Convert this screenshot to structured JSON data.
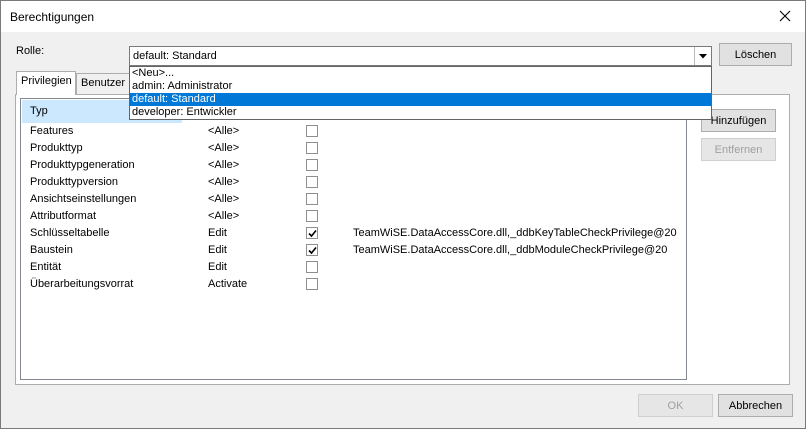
{
  "window": {
    "title": "Berechtigungen"
  },
  "rolle": {
    "label": "Rolle:",
    "selected": "default: Standard",
    "options": [
      "<Neu>...",
      "admin: Administrator",
      "default: Standard",
      "developer: Entwickler"
    ],
    "highlighted_index": 2
  },
  "buttons": {
    "loeschen": "Löschen",
    "hinzufuegen": "Hinzufügen",
    "entfernen": "Entfernen",
    "ok": "OK",
    "abbrechen": "Abbrechen"
  },
  "tabs": [
    {
      "label": "Privilegien",
      "active": true
    },
    {
      "label": "Benutzer",
      "active": false
    }
  ],
  "list": {
    "header": "Typ",
    "rows": [
      {
        "name": "Features",
        "level": "<Alle>",
        "checked": false,
        "info": ""
      },
      {
        "name": "Produkttyp",
        "level": "<Alle>",
        "checked": false,
        "info": ""
      },
      {
        "name": "Produkttypgeneration",
        "level": "<Alle>",
        "checked": false,
        "info": ""
      },
      {
        "name": "Produkttypversion",
        "level": "<Alle>",
        "checked": false,
        "info": ""
      },
      {
        "name": "Ansichtseinstellungen",
        "level": "<Alle>",
        "checked": false,
        "info": ""
      },
      {
        "name": "Attributformat",
        "level": "<Alle>",
        "checked": false,
        "info": ""
      },
      {
        "name": "Schlüsseltabelle",
        "level": "Edit",
        "checked": true,
        "info": "TeamWiSE.DataAccessCore.dll,_ddbKeyTableCheckPrivilege@20"
      },
      {
        "name": "Baustein",
        "level": "Edit",
        "checked": true,
        "info": "TeamWiSE.DataAccessCore.dll,_ddbModuleCheckPrivilege@20"
      },
      {
        "name": "Entität",
        "level": "Edit",
        "checked": false,
        "info": ""
      },
      {
        "name": "Überarbeitungsvorrat",
        "level": "Activate",
        "checked": false,
        "info": ""
      }
    ]
  }
}
